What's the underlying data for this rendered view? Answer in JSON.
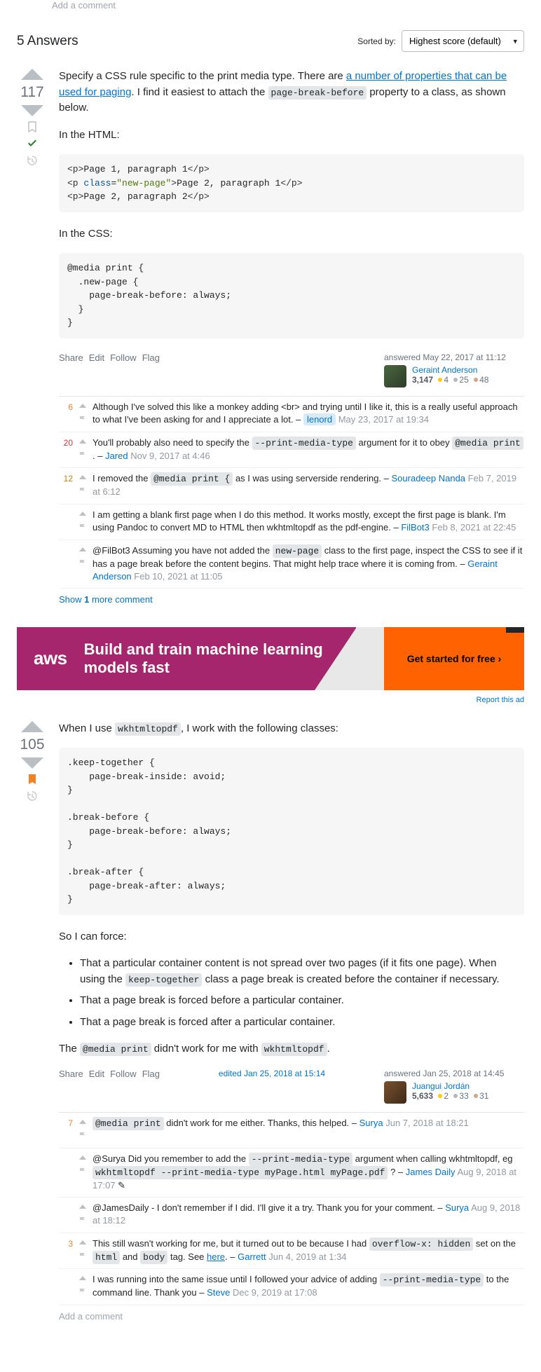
{
  "topAddComment": "Add a comment",
  "header": {
    "count": "5 Answers",
    "sortLabel": "Sorted by:",
    "sortValue": "Highest score (default)"
  },
  "answers": [
    {
      "score": "117",
      "accepted": true,
      "bookmarked": false,
      "introPre": "Specify a CSS rule specific to the print media type. There are ",
      "introLink": "a number of properties that can be used for paging",
      "introMid": ". I find it easiest to attach the ",
      "introCode": "page-break-before",
      "introPost": " property to a class, as shown below.",
      "htmlLabel": "In the HTML:",
      "codeHtml": "<p>Page 1, paragraph 1</p>\n<p class=\"new-page\">Page 2, paragraph 1</p>\n<p>Page 2, paragraph 2</p>",
      "cssLabel": "In the CSS:",
      "codeCss": "@media print {\n  .new-page {\n    page-break-before: always;\n  }\n}",
      "menu": [
        "Share",
        "Edit",
        "Follow",
        "Flag"
      ],
      "answered": "answered May 22, 2017 at 11:12",
      "user": {
        "name": "Geraint Anderson",
        "rep": "3,147",
        "gold": "4",
        "silver": "25",
        "bronze": "48"
      },
      "comments": [
        {
          "score": "6",
          "text": "Although I've solved this like a monkey adding <br> and trying until I like it, this is a really useful approach to what I've been asking for and I appreciate a lot.",
          "user": "lenord",
          "userHL": true,
          "date": "May 23, 2017 at 19:34"
        },
        {
          "score": "20",
          "parts": [
            {
              "t": "You'll probably also need to specify the "
            },
            {
              "c": "--print-media-type"
            },
            {
              "t": " argument for it to obey "
            },
            {
              "c": "@media print"
            },
            {
              "t": " ."
            }
          ],
          "user": "Jared",
          "date": "Nov 9, 2017 at 4:46"
        },
        {
          "score": "12",
          "parts": [
            {
              "t": "I removed the "
            },
            {
              "c": "@media print {"
            },
            {
              "t": " as I was using serverside rendering."
            }
          ],
          "user": "Souradeep Nanda",
          "date": "Feb 7, 2019 at 6:12"
        },
        {
          "score": "",
          "text": "I am getting a blank first page when I do this method. It works mostly, except the first page is blank. I'm using Pandoc to convert MD to HTML then wkhtmltopdf as the pdf-engine.",
          "user": "FilBot3",
          "date": "Feb 8, 2021 at 22:45"
        },
        {
          "score": "",
          "parts": [
            {
              "t": "@FilBot3 Assuming you have not added the "
            },
            {
              "c": "new-page"
            },
            {
              "t": " class to the first page, inspect the CSS to see if it has a page break before the content begins. That might help trace where it is coming from."
            }
          ],
          "user": "Geraint Anderson",
          "date": "Feb 10, 2021 at 11:05"
        }
      ],
      "showMore": "Show 1 more comment"
    },
    {
      "score": "105",
      "bookmarked": true,
      "p1Pre": "When I use ",
      "p1Code": "wkhtmltopdf",
      "p1Post": ", I work with the following classes:",
      "code": ".keep-together {\n    page-break-inside: avoid;\n}\n\n.break-before {\n    page-break-before: always;\n}\n\n.break-after {\n    page-break-after: always;\n}",
      "p2": "So I can force:",
      "bullets": [
        {
          "pre": "That a particular container content is not spread over two pages (if it fits one page). When using the ",
          "code": "keep-together",
          "post": " class a page break is created before the container if necessary."
        },
        {
          "pre": "That a page break is forced before a particular container."
        },
        {
          "pre": "That a page break is forced after a particular container."
        }
      ],
      "p3Pre": "The ",
      "p3Code1": "@media print",
      "p3Mid": " didn't work for me with ",
      "p3Code2": "wkhtmltopdf",
      "p3Post": ".",
      "menu": [
        "Share",
        "Edit",
        "Follow",
        "Flag"
      ],
      "edited": "edited Jan 25, 2018 at 15:14",
      "answered": "answered Jan 25, 2018 at 14:45",
      "user": {
        "name": "Juangui Jordán",
        "rep": "5,633",
        "gold": "2",
        "silver": "33",
        "bronze": "31"
      },
      "comments": [
        {
          "score": "7",
          "parts": [
            {
              "c": "@media print"
            },
            {
              "t": " didn't work for me either. Thanks, this helped."
            }
          ],
          "user": "Surya",
          "date": "Jun 7, 2018 at 18:21"
        },
        {
          "score": "",
          "parts": [
            {
              "t": "@Surya Did you remember to add the "
            },
            {
              "c": "--print-media-type"
            },
            {
              "t": " argument when calling wkhtmltopdf, eg "
            },
            {
              "c": "wkhtmltopdf --print-media-type myPage.html myPage.pdf"
            },
            {
              "t": " ?"
            }
          ],
          "user": "James Daily",
          "date": "Aug 9, 2018 at 17:07",
          "edited": true
        },
        {
          "score": "",
          "text": "@JamesDaily - I don't remember if I did. I'll give it a try. Thank you for your comment.",
          "user": "Surya",
          "date": "Aug 9, 2018 at 18:12"
        },
        {
          "score": "3",
          "parts": [
            {
              "t": "This still wasn't working for me, but it turned out to be because I had "
            },
            {
              "c": "overflow-x: hidden"
            },
            {
              "t": " set on the "
            },
            {
              "c": "html"
            },
            {
              "t": " and "
            },
            {
              "c": "body"
            },
            {
              "t": " tag. See "
            },
            {
              "a": "here"
            },
            {
              "t": "."
            }
          ],
          "user": "Garrett",
          "date": "Jun 4, 2019 at 1:34"
        },
        {
          "score": "",
          "parts": [
            {
              "t": "I was running into the same issue until I followed your advice of adding "
            },
            {
              "c": "--print-media-type"
            },
            {
              "t": " to the command line. Thank you"
            }
          ],
          "user": "Steve",
          "date": "Dec 9, 2019 at 17:08"
        }
      ],
      "addComment": "Add a comment"
    }
  ],
  "ad": {
    "brand": "aws",
    "headline": "Build and train machine learning models fast",
    "cta": "Get started for free ›",
    "report": "Report this ad"
  }
}
